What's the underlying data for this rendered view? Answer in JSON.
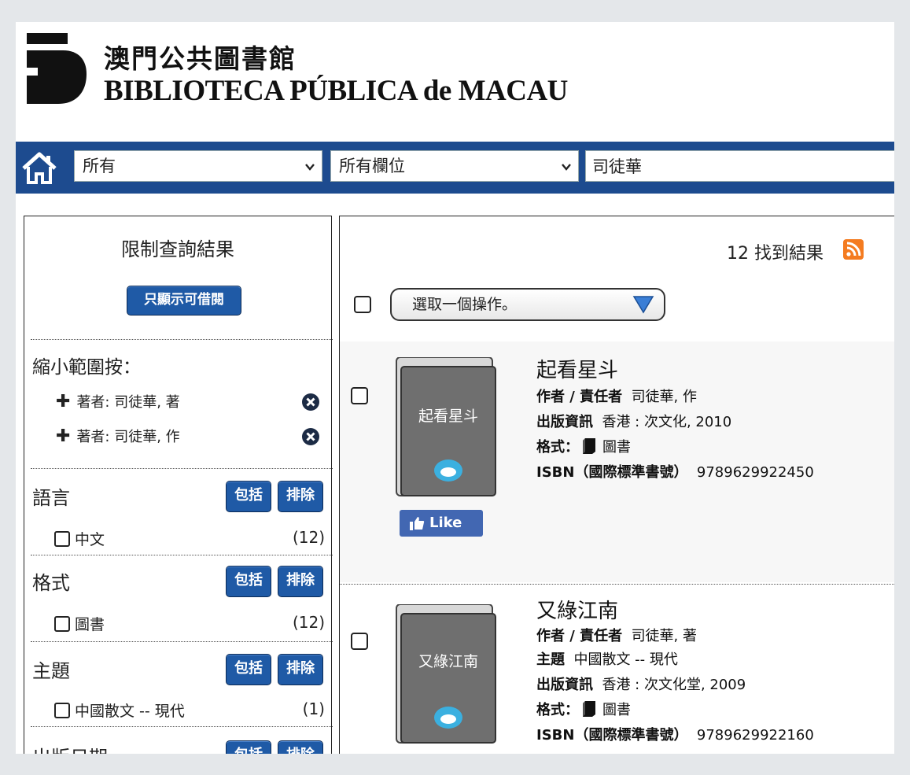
{
  "header": {
    "title_zh": "澳門公共圖書館",
    "title_pt": "BIBLIOTECA PÚBLICA de MACAU"
  },
  "search": {
    "scope_value": "所有",
    "field_value": "所有欄位",
    "query": "司徒華"
  },
  "sidebar": {
    "title": "限制查詢結果",
    "available_button": "只顯示可借閱",
    "narrow_label": "縮小範圍按：",
    "applied_filters": [
      {
        "label": "著者: 司徒華, 著"
      },
      {
        "label": "著者: 司徒華, 作"
      }
    ],
    "include_label": "包括",
    "exclude_label": "排除",
    "facets": [
      {
        "title": "語言",
        "item": "中文",
        "count": "(12)"
      },
      {
        "title": "格式",
        "item": "圖書",
        "count": "(12)"
      },
      {
        "title": "主題",
        "item": "中國散文 -- 現代",
        "count": "(1)"
      },
      {
        "title": "出版日期"
      }
    ]
  },
  "results": {
    "count_text": "12 找到結果",
    "action_placeholder": "選取一個操作。",
    "like_label": "Like",
    "items": [
      {
        "title": "起看星斗",
        "cover_title": "起看星斗",
        "author_label": "作者 / 責任者",
        "author": "司徒華, 作",
        "pub_label": "出版資訊",
        "pub": "香港 : 次文化, 2010",
        "format_label": "格式：",
        "format": "圖書",
        "isbn_label": "ISBN（國際標準書號）",
        "isbn": "9789629922450"
      },
      {
        "title": "又綠江南",
        "cover_title": "又綠江南",
        "author_label": "作者 / 責任者",
        "author": "司徒華, 著",
        "subject_label": "主題",
        "subject": "中國散文 -- 現代",
        "pub_label": "出版資訊",
        "pub": "香港 : 次文化堂, 2009",
        "format_label": "格式：",
        "format": "圖書",
        "isbn_label": "ISBN（國際標準書號）",
        "isbn": "9789629922160"
      }
    ]
  },
  "colors": {
    "nav_blue": "#1d4b8f",
    "button_blue": "#1f5aa6",
    "like_blue": "#4267b2",
    "rss_orange": "#f47b20"
  }
}
